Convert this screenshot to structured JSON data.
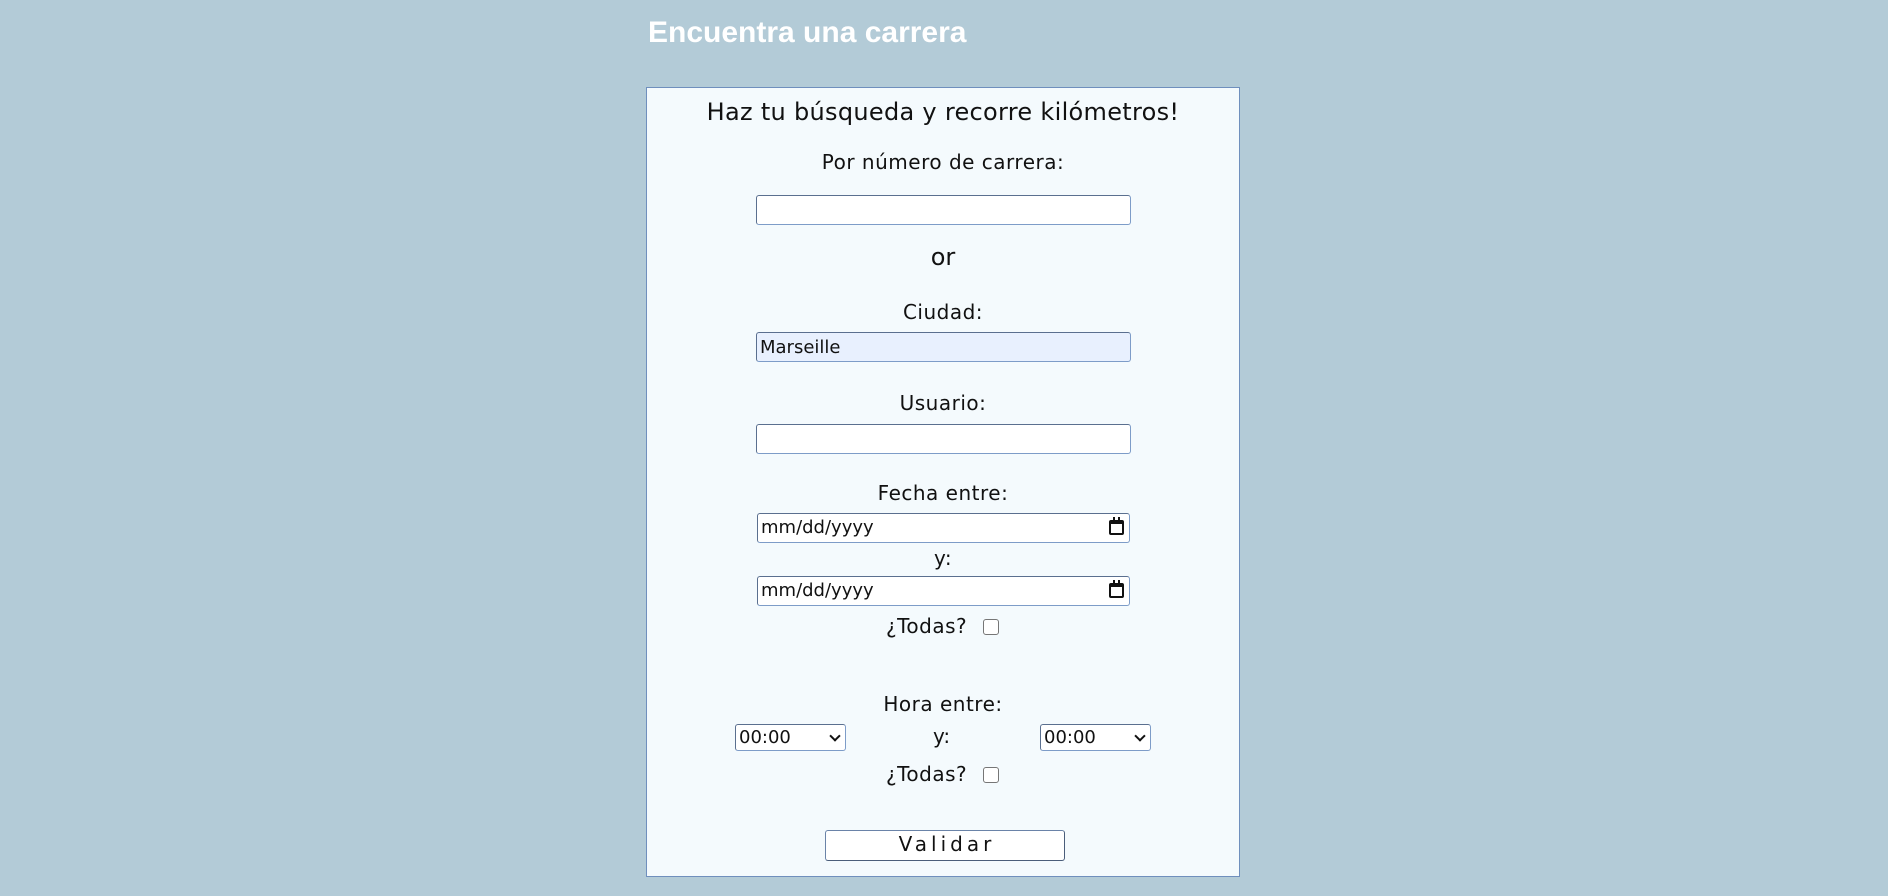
{
  "page": {
    "title": "Encuentra una carrera"
  },
  "form": {
    "heading": "Haz tu búsqueda y recorre kilómetros!",
    "race_number": {
      "label": "Por número de carrera:",
      "value": "",
      "placeholder": ""
    },
    "or_text": "or",
    "city": {
      "label": "Ciudad:",
      "value": "Marseille"
    },
    "user": {
      "label": "Usuario:",
      "value": ""
    },
    "date": {
      "label": "Fecha entre:",
      "from": "mm/dd/yyyy",
      "and_label": "y:",
      "to": "mm/dd/yyyy",
      "all_label": "¿Todas?",
      "all_checked": false
    },
    "time": {
      "label": "Hora entre:",
      "from": "00:00",
      "and_label": "y:",
      "to": "00:00",
      "all_label": "¿Todas?",
      "all_checked": false
    },
    "submit_label": "Validar"
  },
  "icons": {
    "date_picker": "calendar-icon",
    "select_arrow": "chevron-down-icon"
  },
  "colors": {
    "background": "#b3cbd7",
    "panel": "#f4fafd",
    "panel_border": "#6f8fbd",
    "title": "#ffffff",
    "autofill": "#e8f0fe"
  }
}
